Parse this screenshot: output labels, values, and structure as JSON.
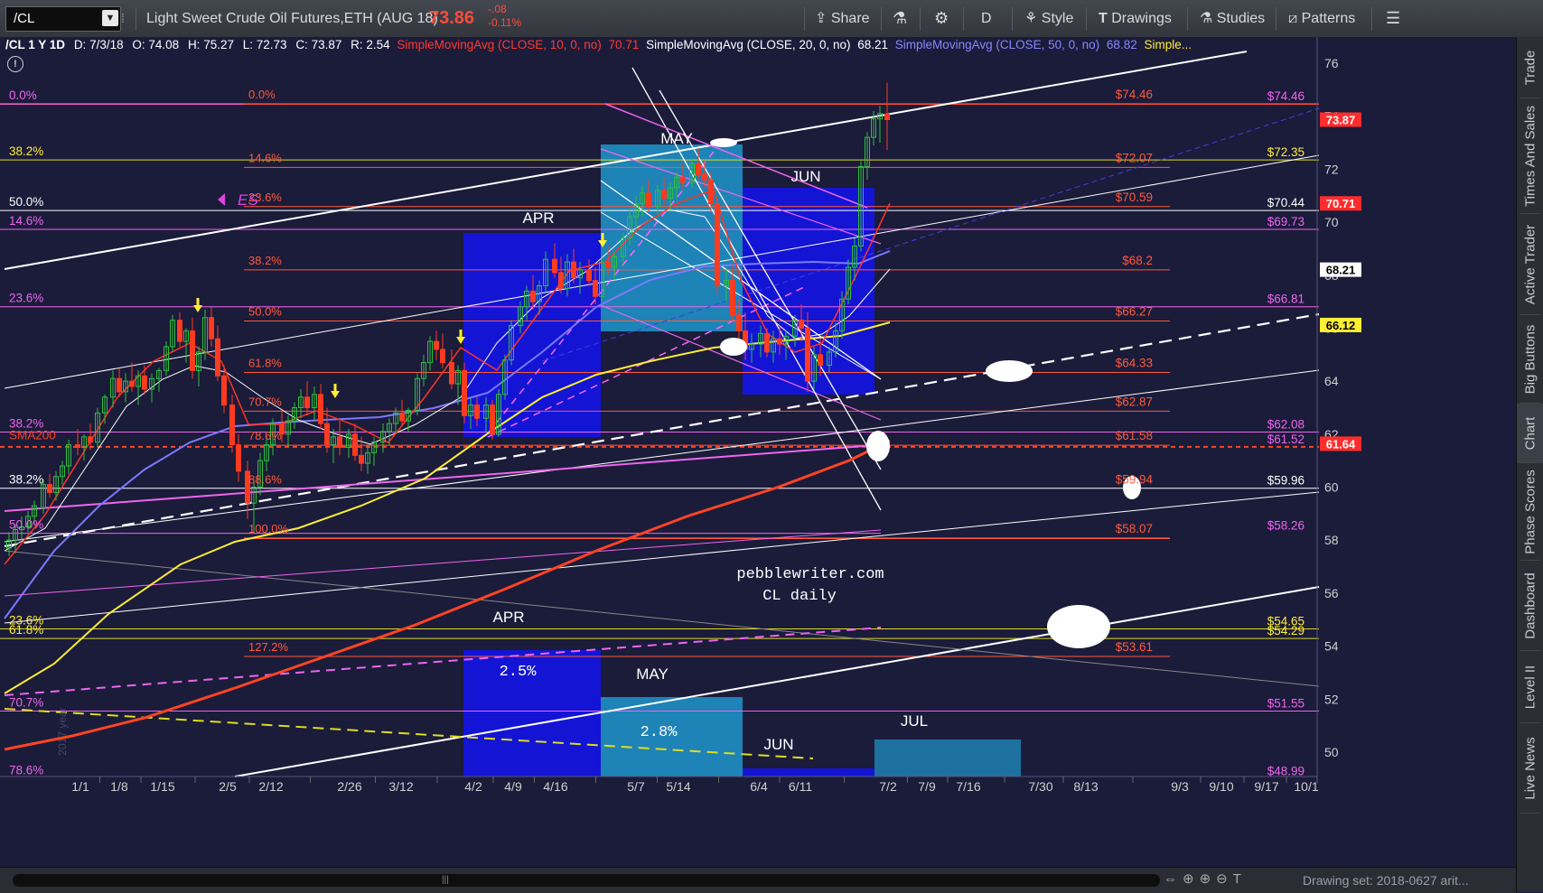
{
  "toolbar": {
    "symbol": "/CL",
    "title": "Light Sweet Crude Oil Futures,ETH (AUG 18)",
    "last_price": "73.86",
    "change": "-.08",
    "change_pct": "-0.11%",
    "share": "Share",
    "interval": "D",
    "style": "Style",
    "drawings": "Drawings",
    "studies": "Studies",
    "patterns": "Patterns"
  },
  "header": {
    "symbol_info": "/CL 1 Y 1D",
    "date": "D: 7/3/18",
    "open": "O: 74.08",
    "high": "H: 75.27",
    "low": "L: 72.73",
    "close": "C: 73.87",
    "range": "R: 2.54",
    "sma10_label": "SimpleMovingAvg (CLOSE, 10, 0, no)",
    "sma10_value": "70.71",
    "sma20_label": "SimpleMovingAvg (CLOSE, 20, 0, no)",
    "sma20_value": "68.21",
    "sma50_label": "SimpleMovingAvg (CLOSE, 50, 0, no)",
    "sma50_value": "68.82",
    "more": "Simple..."
  },
  "sidebar": {
    "tabs": [
      "Trade",
      "Times And Sales",
      "Active Trader",
      "Big Buttons",
      "Chart",
      "Phase Scores",
      "Dashboard",
      "Level II",
      "Live News"
    ]
  },
  "bottom": {
    "drawing_set": "Drawing set: 2018-0627 arit..."
  },
  "colors": {
    "background": "#1b1b3a",
    "price_up": "#2fbf3f",
    "price_down": "#ff3b1f",
    "fib_red": "#ff5a3a",
    "fib_magenta": "#ee66ee",
    "sma_yellow": "#ffee33"
  },
  "chart_data": {
    "type": "candlestick",
    "y_axis": {
      "ticks": [
        76,
        74,
        72,
        70,
        68,
        66,
        64,
        62,
        60,
        58,
        56,
        54,
        52,
        50
      ],
      "ylim": [
        49,
        76.5
      ]
    },
    "x_axis": {
      "ticks": [
        "1/1",
        "1/8",
        "1/15",
        "2/5",
        "2/12",
        "2/26",
        "3/12",
        "4/2",
        "4/9",
        "4/16",
        "5/7",
        "5/14",
        "6/4",
        "6/11",
        "7/2",
        "7/9",
        "7/16",
        "7/30",
        "8/13",
        "9/3",
        "9/10",
        "9/17",
        "10/1"
      ]
    },
    "price_tags": [
      {
        "label": "73.87",
        "price": 73.87,
        "bg": "#ff2d2d",
        "fg": "#ffffff"
      },
      {
        "label": "70.71",
        "price": 70.71,
        "bg": "#ff2d2d",
        "fg": "#ffffff"
      },
      {
        "label": "68.21",
        "price": 68.21,
        "bg": "#ffffff",
        "fg": "#000000"
      },
      {
        "label": "66.12",
        "price": 66.12,
        "bg": "#ffee33",
        "fg": "#000000"
      },
      {
        "label": "61.64",
        "price": 61.64,
        "bg": "#ff2d2d",
        "fg": "#ffffff"
      }
    ],
    "right_levels": [
      {
        "label": "$74.46",
        "price": 74.46,
        "color": "#ee66ee"
      },
      {
        "label": "$72.35",
        "price": 72.35,
        "color": "#ffee33"
      },
      {
        "label": "$70.44",
        "price": 70.44,
        "color": "#ffffff"
      },
      {
        "label": "$69.73",
        "price": 69.73,
        "color": "#ee66ee"
      },
      {
        "label": "$66.81",
        "price": 66.81,
        "color": "#ee66ee"
      },
      {
        "label": "$62.08",
        "price": 62.08,
        "color": "#ee66ee"
      },
      {
        "label": "$61.52",
        "price": 61.52,
        "color": "#ee66ee"
      },
      {
        "label": "$59.96",
        "price": 59.96,
        "color": "#ffffff"
      },
      {
        "label": "$58.26",
        "price": 58.26,
        "color": "#ee66ee"
      },
      {
        "label": "$54.65",
        "price": 54.65,
        "color": "#ffee33"
      },
      {
        "label": "$54.29",
        "price": 54.29,
        "color": "#ffee33"
      },
      {
        "label": "$51.55",
        "price": 51.55,
        "color": "#ee66ee"
      },
      {
        "label": "$48.99",
        "price": 48.99,
        "color": "#ee66ee"
      }
    ],
    "mid_levels": [
      {
        "label": "$74.46",
        "price": 74.46
      },
      {
        "label": "$72.07",
        "price": 72.07
      },
      {
        "label": "$70.59",
        "price": 70.59
      },
      {
        "label": "$68.2",
        "price": 68.2
      },
      {
        "label": "$66.27",
        "price": 66.27
      },
      {
        "label": "$64.33",
        "price": 64.33
      },
      {
        "label": "$62.87",
        "price": 62.87
      },
      {
        "label": "$61.58",
        "price": 61.58
      },
      {
        "label": "$59.94",
        "price": 59.94
      },
      {
        "label": "$58.07",
        "price": 58.07
      },
      {
        "label": "$53.61",
        "price": 53.61
      }
    ],
    "fib_center": [
      {
        "label": "0.0%",
        "price": 74.46
      },
      {
        "label": "14.6%",
        "price": 72.07
      },
      {
        "label": "23.6%",
        "price": 70.59
      },
      {
        "label": "38.2%",
        "price": 68.2
      },
      {
        "label": "50.0%",
        "price": 66.27
      },
      {
        "label": "61.8%",
        "price": 64.33
      },
      {
        "label": "70.7%",
        "price": 62.87
      },
      {
        "label": "78.6%",
        "price": 61.58
      },
      {
        "label": "88.6%",
        "price": 59.94
      },
      {
        "label": "100.0%",
        "price": 58.07
      },
      {
        "label": "127.2%",
        "price": 53.61
      }
    ],
    "fib_left": [
      {
        "label": "0.0%",
        "price": 74.46,
        "color": "#ee66ee"
      },
      {
        "label": "38.2%",
        "price": 72.35,
        "color": "#ffee33"
      },
      {
        "label": "50.0%",
        "price": 70.44,
        "color": "#ffffff"
      },
      {
        "label": "14.6%",
        "price": 69.73,
        "color": "#ee66ee"
      },
      {
        "label": "23.6%",
        "price": 66.81,
        "color": "#ee66ee"
      },
      {
        "label": "38.2%",
        "price": 62.08,
        "color": "#ee66ee"
      },
      {
        "label": "SMA200",
        "price": 61.64,
        "color": "#ff4422"
      },
      {
        "label": "38.2%",
        "price": 59.96,
        "color": "#ffffff"
      },
      {
        "label": "50.0%",
        "price": 58.26,
        "color": "#ee66ee"
      },
      {
        "label": "23.6%",
        "price": 54.65,
        "color": "#ffee33"
      },
      {
        "label": "61.8%",
        "price": 54.29,
        "color": "#ffee33"
      },
      {
        "label": "70.7%",
        "price": 51.55,
        "color": "#ee66ee"
      },
      {
        "label": "78.6%",
        "price": 48.99,
        "color": "#ee66ee"
      }
    ],
    "annotations": {
      "es": "ES",
      "apr_top": "APR",
      "may_top": "MAY",
      "jun_top": "JUN",
      "apr_bottom": "APR",
      "may_bottom": "MAY",
      "jun_bottom": "JUN",
      "jul_bottom": "JUL",
      "apr_pct": "2.5%",
      "may_pct": "2.8%",
      "watermark1": "pebblewriter.com",
      "watermark2": "CL daily",
      "year_label": "2017 year"
    }
  }
}
